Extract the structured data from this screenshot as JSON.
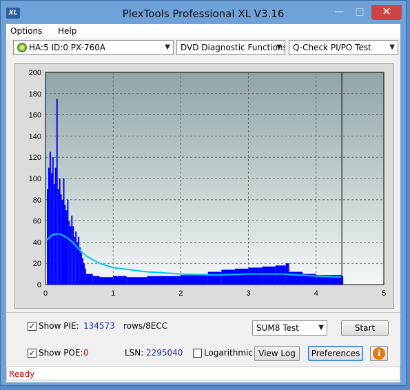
{
  "window": {
    "title": "PlexTools Professional XL V3.16",
    "icon_label": "XL"
  },
  "menu": {
    "items": [
      "Options",
      "Help"
    ]
  },
  "toolbar": {
    "drive": "HA:5 ID:0  PX-760A",
    "function": "DVD Diagnostic Functions",
    "test": "Q-Check PI/PO Test"
  },
  "chart_data": {
    "type": "bar",
    "title": "",
    "xlabel": "",
    "ylabel": "",
    "xlim": [
      0,
      5
    ],
    "ylim": [
      0,
      200
    ],
    "x_ticks": [
      "0",
      "1",
      "2",
      "3",
      "4",
      "5"
    ],
    "y_ticks": [
      "0",
      "20",
      "40",
      "60",
      "80",
      "100",
      "120",
      "140",
      "160",
      "180",
      "200"
    ],
    "grid": true,
    "end_marker_x": 4.38,
    "series": [
      {
        "type": "bar",
        "color": "#0000ff",
        "x": [
          0.02,
          0.04,
          0.06,
          0.08,
          0.1,
          0.12,
          0.14,
          0.16,
          0.18,
          0.2,
          0.22,
          0.24,
          0.26,
          0.28,
          0.3,
          0.32,
          0.34,
          0.36,
          0.38,
          0.4,
          0.42,
          0.44,
          0.46,
          0.48,
          0.5,
          0.52,
          0.54,
          0.56,
          0.58,
          0.6,
          0.7,
          0.8,
          1.0,
          1.2,
          1.5,
          1.8,
          2.0,
          2.2,
          2.4,
          2.6,
          2.8,
          3.0,
          3.2,
          3.4,
          3.55,
          3.6,
          3.8,
          4.0,
          4.2,
          4.38
        ],
        "y": [
          90,
          110,
          125,
          105,
          120,
          95,
          110,
          175,
          90,
          100,
          85,
          80,
          100,
          75,
          70,
          80,
          60,
          55,
          65,
          55,
          45,
          50,
          40,
          45,
          35,
          30,
          25,
          20,
          15,
          10,
          8,
          7,
          8,
          7,
          8,
          8,
          9,
          10,
          12,
          14,
          15,
          16,
          17,
          18,
          20,
          12,
          10,
          9,
          9,
          8
        ]
      },
      {
        "type": "line",
        "color": "#00c8f0",
        "x": [
          0.02,
          0.1,
          0.2,
          0.3,
          0.4,
          0.5,
          0.6,
          0.8,
          1.0,
          1.5,
          2.0,
          2.5,
          3.0,
          3.5,
          4.0,
          4.38
        ],
        "y": [
          42,
          47,
          48,
          45,
          40,
          33,
          27,
          20,
          16,
          12,
          10,
          9,
          10,
          10,
          8,
          7
        ]
      }
    ]
  },
  "controls": {
    "show_pie_label": "Show PIE:",
    "pie_value": "134573",
    "pie_unit": "rows/8ECC",
    "show_poe_label": "Show POE:",
    "poe_value": "0",
    "lsn_label": "LSN:",
    "lsn_value": "2295040",
    "log_label": "Logarithmic",
    "sum_select": "SUM8 Test",
    "start": "Start",
    "view_log": "View Log",
    "preferences": "Preferences",
    "check": "✓"
  },
  "status": {
    "text": "Ready"
  }
}
